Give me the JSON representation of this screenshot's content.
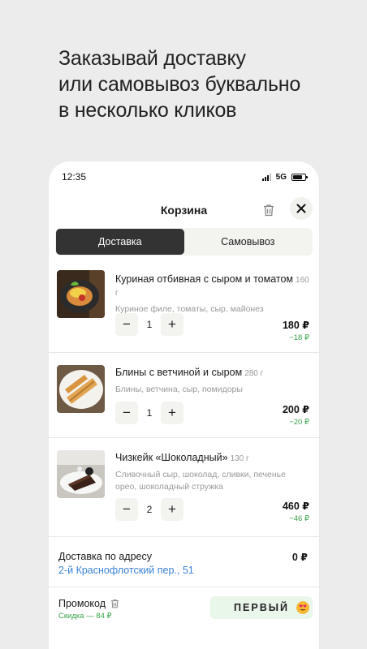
{
  "headline": {
    "lines": [
      "Заказывай доставку",
      "или самовывоз буквально",
      "в несколько кликов"
    ]
  },
  "status": {
    "time": "12:35",
    "network": "5G"
  },
  "cart": {
    "title": "Корзина",
    "tabs": [
      {
        "label": "Доставка",
        "active": true
      },
      {
        "label": "Самовывоз",
        "active": false
      }
    ],
    "items": [
      {
        "name": "Куриная отбивная с сыром и томатом",
        "weight": "160 г",
        "description": "Куриное филе, томаты, сыр, майонез",
        "quantity": "1",
        "price": "180 ₽",
        "discount": "−18 ₽"
      },
      {
        "name": "Блины с ветчиной и сыром",
        "weight": "280 г",
        "description": "Блины, ветчина, сыр, помидоры",
        "quantity": "1",
        "price": "200 ₽",
        "discount": "−20 ₽"
      },
      {
        "name": "Чизкейк «Шоколадный»",
        "weight": "130 г",
        "description": "Сливочный сыр, шоколад, сливки, печенье орео, шоколадный стружка",
        "quantity": "2",
        "price": "460 ₽",
        "discount": "−46 ₽"
      }
    ],
    "delivery": {
      "label": "Доставка по адресу",
      "address": "2-й Краснофлотский пер., 51",
      "cost": "0 ₽"
    },
    "promo": {
      "label": "Промокод",
      "discount_text": "Скидка — 84 ₽",
      "code": "ПЕРВЫЙ"
    }
  },
  "colors": {
    "accent_green": "#3aa14b",
    "link_blue": "#3b82d6",
    "tab_active": "#333333"
  }
}
